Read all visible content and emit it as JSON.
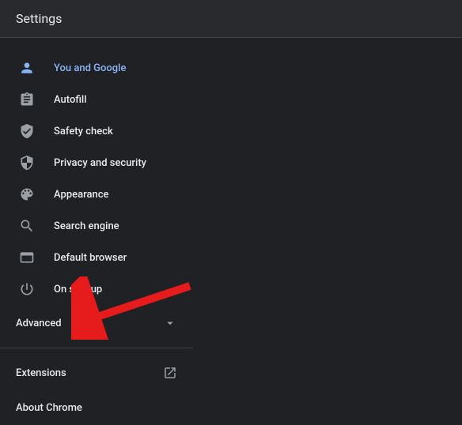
{
  "header": {
    "title": "Settings"
  },
  "nav": {
    "items": [
      {
        "label": "You and Google",
        "icon": "person-icon",
        "active": true
      },
      {
        "label": "Autofill",
        "icon": "autofill-icon",
        "active": false
      },
      {
        "label": "Safety check",
        "icon": "safety-check-icon",
        "active": false
      },
      {
        "label": "Privacy and security",
        "icon": "shield-icon",
        "active": false
      },
      {
        "label": "Appearance",
        "icon": "palette-icon",
        "active": false
      },
      {
        "label": "Search engine",
        "icon": "search-icon",
        "active": false
      },
      {
        "label": "Default browser",
        "icon": "browser-icon",
        "active": false
      },
      {
        "label": "On startup",
        "icon": "power-icon",
        "active": false
      }
    ]
  },
  "sections": {
    "advanced": "Advanced",
    "extensions": "Extensions",
    "about": "About Chrome"
  },
  "annotation": {
    "arrow_target": "advanced"
  }
}
